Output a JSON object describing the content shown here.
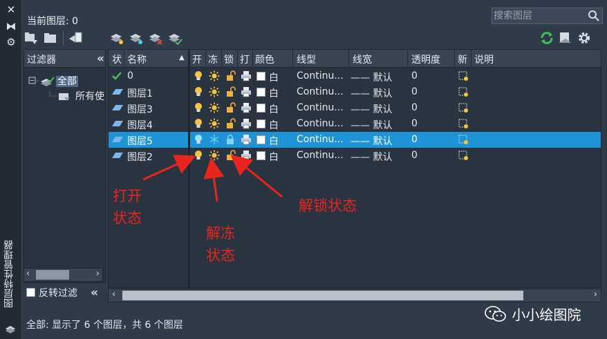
{
  "window": {
    "close_glyph": "✕",
    "autohide_glyph": "⧓",
    "settings_glyph": "⚙",
    "vertical_title": "图层特性管理器"
  },
  "header": {
    "current_layer": "当前图层: 0",
    "search_placeholder": "搜索图层"
  },
  "filters": {
    "title": "过滤器",
    "tree": [
      {
        "label": "全部",
        "selected": true
      },
      {
        "label": "所有使"
      }
    ],
    "invert_label": "反转过滤"
  },
  "columns": [
    "状",
    "名称",
    "开",
    "冻",
    "锁",
    "打",
    "颜色",
    "线型",
    "线宽",
    "透明度",
    "新",
    "说明"
  ],
  "layers": [
    {
      "status": "current",
      "name": "0",
      "on": true,
      "frozen": false,
      "locked": false,
      "color_name": "白",
      "linetype": "Continu...",
      "lineweight": "—— 默认",
      "transparency": "0",
      "selected": false
    },
    {
      "status": "layer",
      "name": "图层1",
      "on": true,
      "frozen": false,
      "locked": false,
      "color_name": "白",
      "linetype": "Continu...",
      "lineweight": "—— 默认",
      "transparency": "0",
      "selected": false
    },
    {
      "status": "layer",
      "name": "图层3",
      "on": true,
      "frozen": false,
      "locked": false,
      "color_name": "白",
      "linetype": "Continu...",
      "lineweight": "—— 默认",
      "transparency": "0",
      "selected": false
    },
    {
      "status": "layer",
      "name": "图层4",
      "on": true,
      "frozen": false,
      "locked": false,
      "color_name": "白",
      "linetype": "Continu...",
      "lineweight": "—— 默认",
      "transparency": "0",
      "selected": false
    },
    {
      "status": "layer",
      "name": "图层5",
      "on": true,
      "frozen": true,
      "locked": true,
      "color_name": "白",
      "linetype": "Continu...",
      "lineweight": "—— 默认",
      "transparency": "0",
      "selected": true
    },
    {
      "status": "layer",
      "name": "图层2",
      "on": true,
      "frozen": false,
      "locked": false,
      "color_name": "白",
      "linetype": "Continu...",
      "lineweight": "—— 默认",
      "transparency": "0",
      "selected": false
    }
  ],
  "status_bar": "全部: 显示了 6 个图层，共 6 个图层",
  "annotations": [
    {
      "text": "打开\n状态"
    },
    {
      "text": "解冻\n状态"
    },
    {
      "text": "解锁状态"
    }
  ],
  "watermark": "小小绘图院",
  "colors": {
    "accent_selected": "#1e93d6",
    "annotation_red": "#e8261e",
    "bulb_on": "#f5c542",
    "lock_open": "#f0b03a",
    "freeze_blue": "#59c6f0"
  }
}
